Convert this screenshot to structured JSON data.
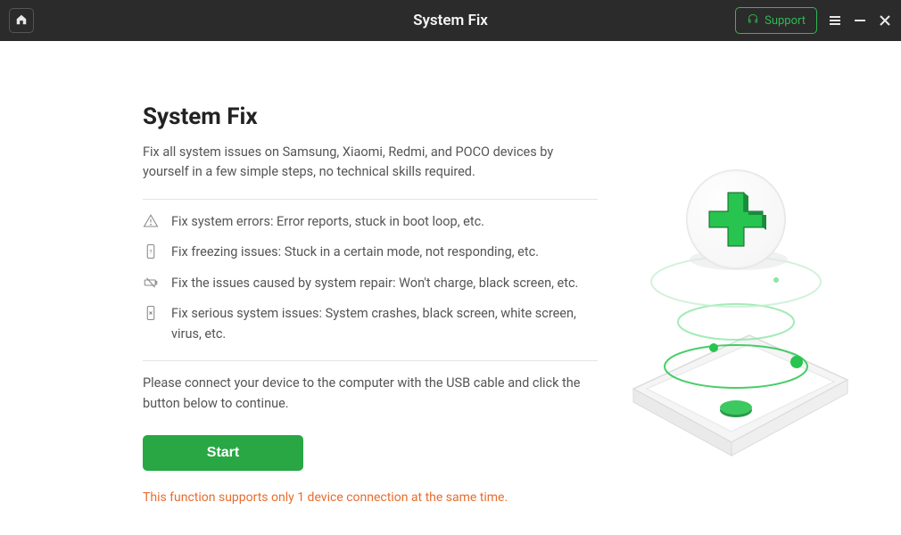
{
  "titlebar": {
    "title": "System Fix",
    "support_label": "Support"
  },
  "page": {
    "heading": "System Fix",
    "subheading": "Fix all system issues on Samsung, Xiaomi, Redmi, and POCO devices by yourself in a few simple steps, no technical skills required.",
    "features": [
      "Fix system errors: Error reports, stuck in boot loop, etc.",
      "Fix freezing issues: Stuck in a certain mode, not responding, etc.",
      "Fix the issues caused by system repair: Won't charge, black screen, etc.",
      "Fix serious system issues: System crashes, black screen, white screen, virus, etc."
    ],
    "instruction": "Please connect your device to the computer with the USB cable and click the button below to continue.",
    "start_label": "Start",
    "warning": "This function supports only 1 device connection at the same time."
  }
}
